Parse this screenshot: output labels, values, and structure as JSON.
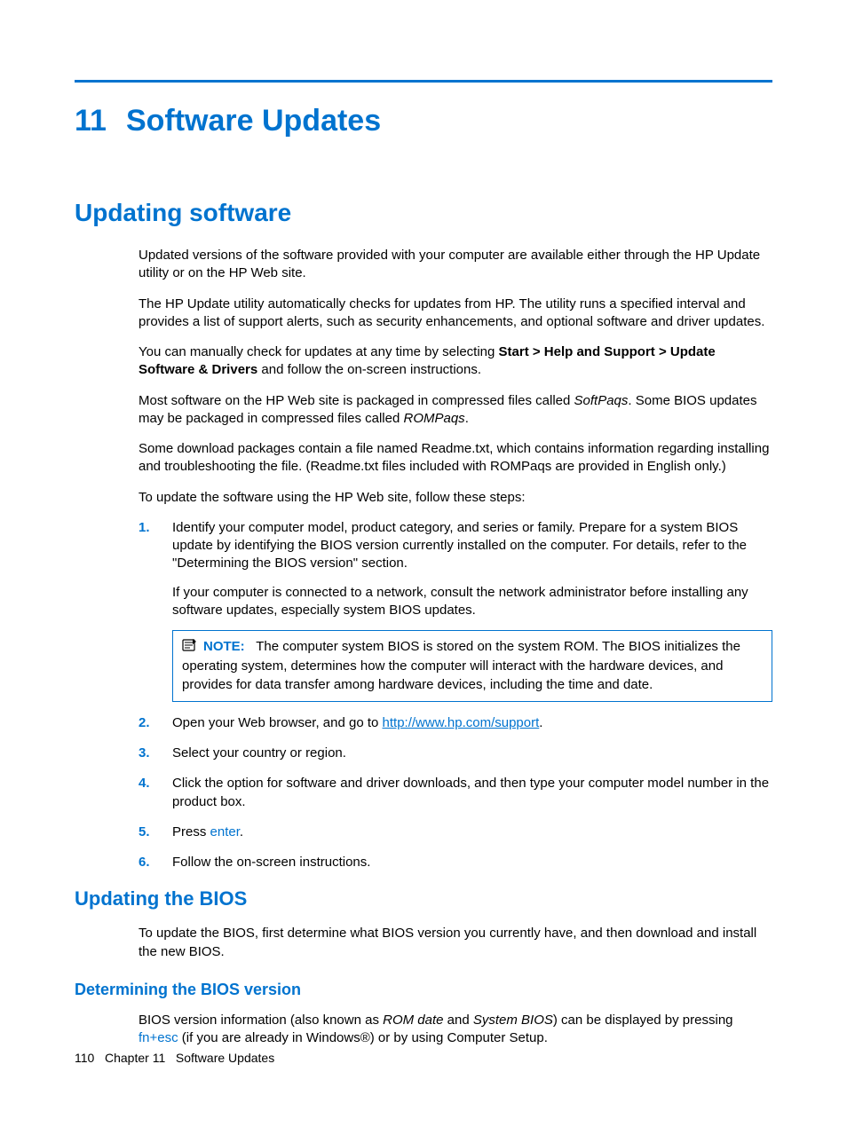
{
  "chapter": {
    "number": "11",
    "title": "Software Updates"
  },
  "section1": {
    "title": "Updating software",
    "p1": "Updated versions of the software provided with your computer are available either through the HP Update utility or on the HP Web site.",
    "p2": "The HP Update utility automatically checks for updates from HP. The utility runs a specified interval and provides a list of support alerts, such as security enhancements, and optional software and driver updates.",
    "p3a": "You can manually check for updates at any time by selecting ",
    "p3b": "Start > Help and Support > Update Software & Drivers",
    "p3c": " and follow the on-screen instructions.",
    "p4a": "Most software on the HP Web site is packaged in compressed files called ",
    "p4b": "SoftPaqs",
    "p4c": ". Some BIOS updates may be packaged in compressed files called ",
    "p4d": "ROMPaqs",
    "p4e": ".",
    "p5": "Some download packages contain a file named Readme.txt, which contains information regarding installing and troubleshooting the file. (Readme.txt files included with ROMPaqs are provided in English only.)",
    "p6": "To update the software using the HP Web site, follow these steps:",
    "steps": {
      "s1_num": "1.",
      "s1a": "Identify your computer model, product category, and series or family. Prepare for a system BIOS update by identifying the BIOS version currently installed on the computer. For details, refer to the \"Determining the BIOS version\" section.",
      "s1b": "If your computer is connected to a network, consult the network administrator before installing any software updates, especially system BIOS updates.",
      "note_label": "NOTE:",
      "note_text": "The computer system BIOS is stored on the system ROM. The BIOS initializes the operating system, determines how the computer will interact with the hardware devices, and provides for data transfer among hardware devices, including the time and date.",
      "s2_num": "2.",
      "s2a": "Open your Web browser, and go to ",
      "s2_link": "http://www.hp.com/support",
      "s2b": ".",
      "s3_num": "3.",
      "s3": "Select your country or region.",
      "s4_num": "4.",
      "s4": "Click the option for software and driver downloads, and then type your computer model number in the product box.",
      "s5_num": "5.",
      "s5a": "Press ",
      "s5_enter": "enter",
      "s5b": ".",
      "s6_num": "6.",
      "s6": "Follow the on-screen instructions."
    }
  },
  "section2": {
    "title": "Updating the BIOS",
    "p1": "To update the BIOS, first determine what BIOS version you currently have, and then download and install the new BIOS."
  },
  "section3": {
    "title": "Determining the BIOS version",
    "p1a": "BIOS version information (also known as ",
    "p1b": "ROM date",
    "p1c": " and ",
    "p1d": "System BIOS",
    "p1e": ") can be displayed by pressing ",
    "p1_key": "fn+esc",
    "p1f": " (if you are already in Windows®) or by using Computer Setup."
  },
  "footer": {
    "page": "110",
    "chapter_label": "Chapter 11",
    "chapter_title": "Software Updates"
  }
}
